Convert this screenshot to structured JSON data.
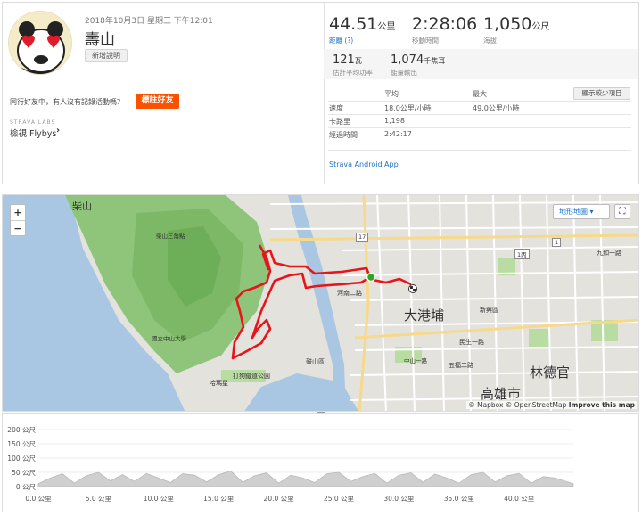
{
  "activity": {
    "date": "2018年10月3日 星期三 下午12:01",
    "title": "壽山",
    "add_description": "新增說明",
    "friends_question": "同行好友中，有人沒有記錄活動嗎？",
    "tag_friends": "標註好友",
    "labs": "STRAVA LABS",
    "flyby": "檢視 Flybys"
  },
  "stats": {
    "distance": "44.51",
    "distance_unit": "公里",
    "distance_label": "距離",
    "moving_time": "2:28:06",
    "moving_time_label": "移動時間",
    "elevation": "1,050",
    "elevation_unit": "公尺",
    "elevation_label": "海拔",
    "power": "121",
    "power_unit": "瓦",
    "power_label": "估計平均功率",
    "energy": "1,074",
    "energy_unit": "千焦耳",
    "energy_label": "能量輸出"
  },
  "detail": {
    "show_less": "顯示較少項目",
    "col_avg": "平均",
    "col_max": "最大",
    "rows": [
      {
        "label": "速度",
        "avg": "18.0公里/小時",
        "max": "49.0公里/小時"
      },
      {
        "label": "卡路里",
        "avg": "1,198",
        "max": ""
      },
      {
        "label": "經過時間",
        "avg": "2:42:17",
        "max": ""
      }
    ],
    "app": "Strava Android App"
  },
  "map": {
    "zoom_in": "+",
    "zoom_out": "−",
    "map_type": "地形地圖",
    "labels": {
      "chaishan": "柴山",
      "shoushan_view": "柴山三角點",
      "dagangpu": "大港埔",
      "lindeguan": "林德官",
      "kaohsiung": "高雄市",
      "xinxing": "新興區",
      "gushan_park": "打狗鐵道公園",
      "nsysu": "國立中山大學",
      "hamasen": "哈瑪星",
      "minsheng": "民生一路",
      "wufu": "五福二路",
      "hehe": "河南二路",
      "chenggong": "九如一路",
      "zhongshan": "中山一路",
      "r17": "17",
      "r1": "1",
      "r1d": "1丙",
      "gushan": "鼓山區"
    },
    "attribution": "© Mapbox © OpenStreetMap",
    "improve": "Improve this map",
    "route_color": "#e8141b",
    "start_color": "#27a81f"
  },
  "chart_data": {
    "type": "area",
    "title": "",
    "xlabel": "",
    "ylabel": "",
    "yticks": [
      "200 公尺",
      "150 公尺",
      "100 公尺",
      "50 公尺",
      "0 公尺"
    ],
    "xticks": [
      "0.0 公里",
      "5.0 公里",
      "10.0 公里",
      "15.0 公里",
      "20.0 公里",
      "25.0 公里",
      "30.0 公里",
      "35.0 公里",
      "40.0 公里"
    ],
    "xlim": [
      0,
      44.51
    ],
    "ylim": [
      0,
      200
    ],
    "color": "#cfcfcf",
    "x": [
      0,
      1,
      2,
      3,
      4,
      5,
      6,
      7,
      8,
      9,
      10,
      11,
      12,
      13,
      14,
      15,
      16,
      17,
      18,
      19,
      20,
      21,
      22,
      23,
      24,
      25,
      26,
      27,
      28,
      29,
      30,
      31,
      32,
      33,
      34,
      35,
      36,
      37,
      38,
      39,
      40,
      41,
      42,
      43,
      44.5
    ],
    "y": [
      10,
      30,
      45,
      12,
      38,
      50,
      20,
      42,
      18,
      46,
      30,
      14,
      45,
      40,
      16,
      42,
      55,
      15,
      38,
      48,
      12,
      40,
      30,
      14,
      45,
      50,
      18,
      35,
      46,
      12,
      40,
      48,
      15,
      44,
      30,
      12,
      42,
      50,
      16,
      38,
      46,
      12,
      35,
      30,
      10
    ]
  }
}
